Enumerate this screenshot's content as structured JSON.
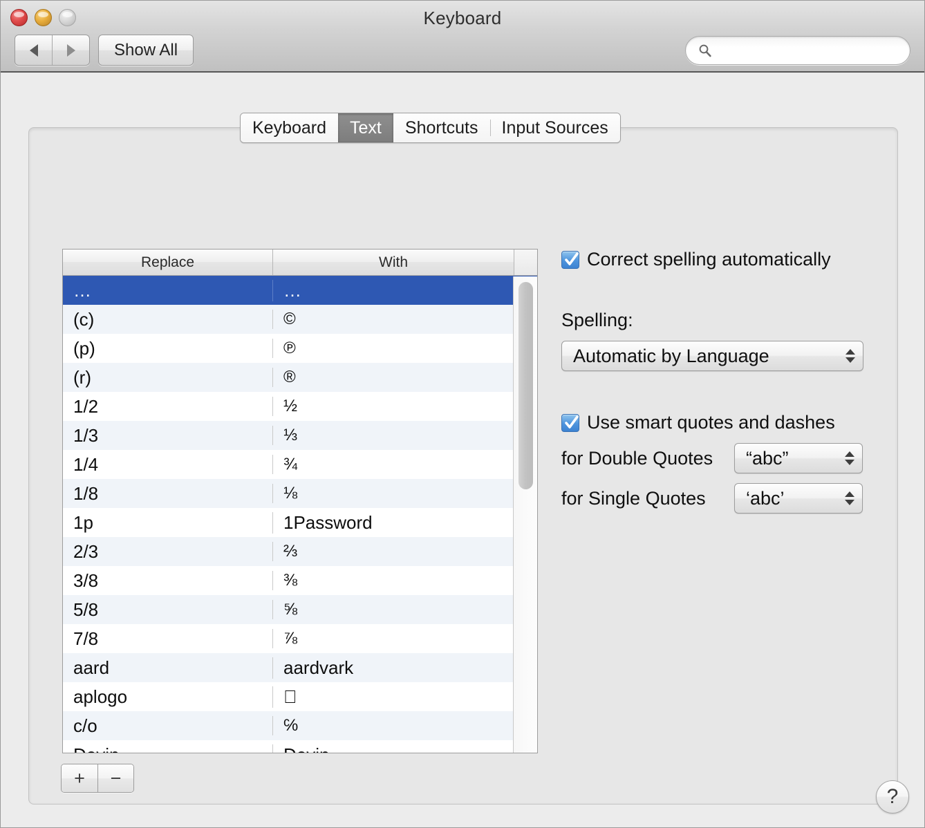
{
  "window": {
    "title": "Keyboard",
    "traffic_lights": [
      "close",
      "minimize",
      "zoom"
    ]
  },
  "toolbar": {
    "back_label": "◀",
    "forward_label": "▶",
    "show_all_label": "Show All",
    "search": {
      "value": "",
      "placeholder": ""
    }
  },
  "tabs": [
    {
      "label": "Keyboard",
      "active": false
    },
    {
      "label": "Text",
      "active": true
    },
    {
      "label": "Shortcuts",
      "active": false
    },
    {
      "label": "Input Sources",
      "active": false
    }
  ],
  "table": {
    "columns": [
      "Replace",
      "With"
    ],
    "rows": [
      {
        "replace": "…",
        "with": "…",
        "selected": true
      },
      {
        "replace": "(c)",
        "with": "©"
      },
      {
        "replace": "(p)",
        "with": "℗"
      },
      {
        "replace": "(r)",
        "with": "®"
      },
      {
        "replace": "1/2",
        "with": "½"
      },
      {
        "replace": "1/3",
        "with": "⅓"
      },
      {
        "replace": "1/4",
        "with": "¾"
      },
      {
        "replace": "1/8",
        "with": "⅛"
      },
      {
        "replace": "1p",
        "with": "1Password"
      },
      {
        "replace": "2/3",
        "with": "⅔"
      },
      {
        "replace": "3/8",
        "with": "⅜"
      },
      {
        "replace": "5/8",
        "with": "⅝"
      },
      {
        "replace": "7/8",
        "with": "⅞"
      },
      {
        "replace": "aard",
        "with": "aardvark"
      },
      {
        "replace": "aplogo",
        "with": ""
      },
      {
        "replace": "c/o",
        "with": "℅"
      },
      {
        "replace": "Devin",
        "with": "Devin"
      }
    ]
  },
  "table_buttons": {
    "add_label": "+",
    "remove_label": "−"
  },
  "options": {
    "correct_spelling": {
      "label": "Correct spelling automatically",
      "checked": true
    },
    "spelling": {
      "label": "Spelling:",
      "value": "Automatic by Language"
    },
    "smart_quotes": {
      "label": "Use smart quotes and dashes",
      "checked": true
    },
    "double_quotes": {
      "label": "for Double Quotes",
      "value": "“abc”"
    },
    "single_quotes": {
      "label": "for Single Quotes",
      "value": "‘abc’"
    }
  },
  "help": {
    "label": "?"
  },
  "colors": {
    "selection_blue": "#2e58b3",
    "checkbox_blue": "#4e94dd",
    "alt_row": "#f0f4f9",
    "tab_active": "#7d7d7d"
  }
}
